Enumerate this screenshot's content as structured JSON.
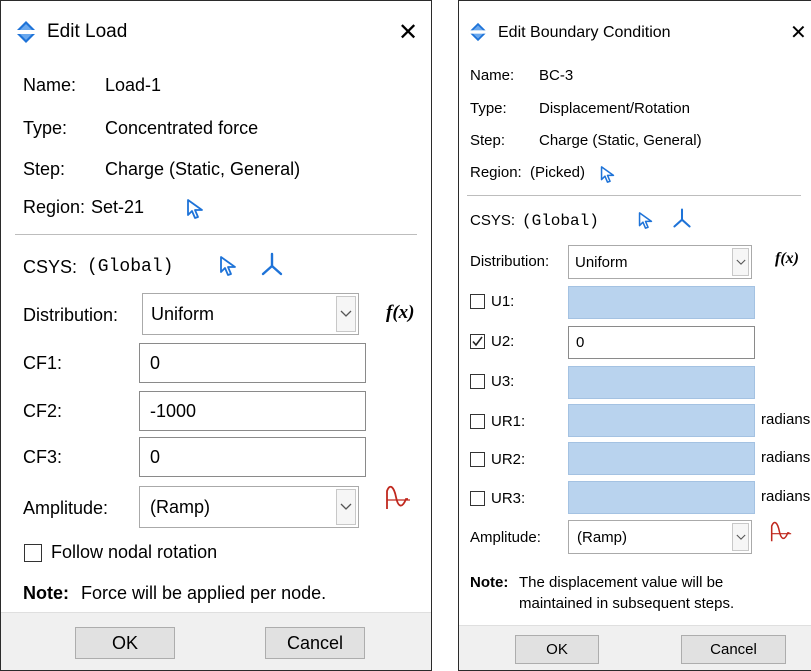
{
  "edit_load": {
    "title": "Edit Load",
    "close_glyph": "✕",
    "name_label": "Name:",
    "name_value": "Load-1",
    "type_label": "Type:",
    "type_value": "Concentrated force",
    "step_label": "Step:",
    "step_value": "Charge (Static, General)",
    "region_label": "Region:",
    "region_value": "Set-21",
    "csys_label": "CSYS:",
    "csys_value": "(Global)",
    "distribution_label": "Distribution:",
    "distribution_value": "Uniform",
    "fx_label": "f(x)",
    "fields": [
      {
        "label": "CF1:",
        "value": "0"
      },
      {
        "label": "CF2:",
        "value": "-1000"
      },
      {
        "label": "CF3:",
        "value": "0"
      }
    ],
    "amplitude_label": "Amplitude:",
    "amplitude_value": "(Ramp)",
    "follow_label": "Follow nodal rotation",
    "follow_checked": false,
    "note_label": "Note:",
    "note_text": "Force will be applied per node.",
    "ok_label": "OK",
    "cancel_label": "Cancel"
  },
  "edit_bc": {
    "title": "Edit Boundary Condition",
    "close_glyph": "✕",
    "name_label": "Name:",
    "name_value": "BC-3",
    "type_label": "Type:",
    "type_value": "Displacement/Rotation",
    "step_label": "Step:",
    "step_value": "Charge (Static, General)",
    "region_label": "Region:",
    "region_value": "(Picked)",
    "csys_label": "CSYS:",
    "csys_value": "(Global)",
    "distribution_label": "Distribution:",
    "distribution_value": "Uniform",
    "fx_label": "f(x)",
    "dofs": [
      {
        "label": "U1:",
        "checked": false,
        "value": "",
        "unit": ""
      },
      {
        "label": "U2:",
        "checked": true,
        "value": "0",
        "unit": ""
      },
      {
        "label": "U3:",
        "checked": false,
        "value": "",
        "unit": ""
      },
      {
        "label": "UR1:",
        "checked": false,
        "value": "",
        "unit": "radians"
      },
      {
        "label": "UR2:",
        "checked": false,
        "value": "",
        "unit": "radians"
      },
      {
        "label": "UR3:",
        "checked": false,
        "value": "",
        "unit": "radians"
      }
    ],
    "amplitude_label": "Amplitude:",
    "amplitude_value": "(Ramp)",
    "note_label": "Note:",
    "note_line1": "The displacement value will be",
    "note_line2": "maintained in subsequent steps.",
    "ok_label": "OK",
    "cancel_label": "Cancel"
  },
  "colors": {
    "accent_blue": "#1e73d8",
    "fx_red": "#c0281e",
    "disabled_field": "#b9d3ee"
  },
  "icons": [
    "app-diamond-icon",
    "close-icon",
    "select-arrow-icon",
    "csys-axes-icon",
    "dropdown-arrow-icon",
    "amplitude-icon"
  ]
}
